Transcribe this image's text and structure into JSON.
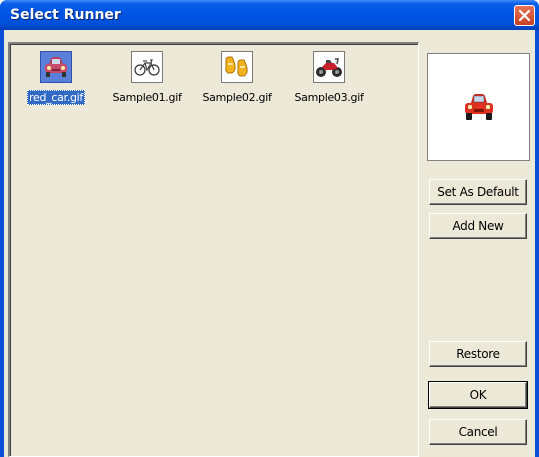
{
  "window": {
    "title": "Select Runner"
  },
  "runners": [
    {
      "filename": "red_car.gif",
      "icon": "red-car-icon",
      "selected": true
    },
    {
      "filename": "Sample01.gif",
      "icon": "bicycle-icon",
      "selected": false
    },
    {
      "filename": "Sample02.gif",
      "icon": "shoes-icon",
      "selected": false
    },
    {
      "filename": "Sample03.gif",
      "icon": "motorcycle-icon",
      "selected": false
    }
  ],
  "preview": {
    "icon": "red-car-icon"
  },
  "buttons": {
    "set_default": "Set As Default",
    "add_new": "Add New",
    "restore": "Restore",
    "ok": "OK",
    "cancel": "Cancel"
  },
  "colors": {
    "titlebar": "#0054e3",
    "selection": "#316ac5",
    "face": "#ece9d8",
    "close": "#c4401f"
  }
}
